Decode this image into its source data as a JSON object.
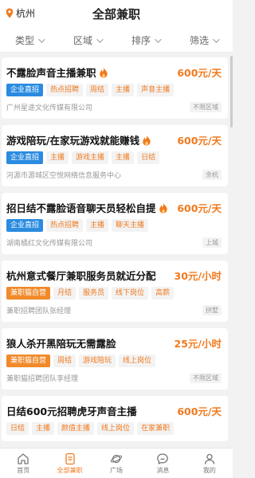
{
  "header": {
    "city": "杭州",
    "title": "全部兼职"
  },
  "filters": [
    {
      "label": "类型"
    },
    {
      "label": "区域"
    },
    {
      "label": "排序"
    },
    {
      "label": "筛选"
    }
  ],
  "jobs": [
    {
      "title": "不露脸声音主播兼职",
      "hot": true,
      "pay": "600元/天",
      "tags": [
        {
          "text": "企业直招",
          "style": "primary"
        },
        {
          "text": "热点招聘",
          "style": "plain"
        },
        {
          "text": "周结",
          "style": "plain"
        },
        {
          "text": "主播",
          "style": "plain"
        },
        {
          "text": "声音主播",
          "style": "plain"
        }
      ],
      "company": "广州星途文化传媒有限公司",
      "area": "不限区域"
    },
    {
      "title": "游戏陪玩/在家玩游戏就能赚钱",
      "hot": true,
      "pay": "600元/天",
      "tags": [
        {
          "text": "企业直招",
          "style": "primary"
        },
        {
          "text": "主播",
          "style": "plain"
        },
        {
          "text": "游戏主播",
          "style": "plain"
        },
        {
          "text": "主播",
          "style": "plain"
        },
        {
          "text": "日结",
          "style": "plain"
        }
      ],
      "company": "河源市源城区空悦网络信息服务中心",
      "area": "余杭"
    },
    {
      "title": "招日结不露脸语音聊天员轻松自提",
      "hot": true,
      "pay": "600元/天",
      "tags": [
        {
          "text": "企业直招",
          "style": "primary"
        },
        {
          "text": "热点招聘",
          "style": "plain"
        },
        {
          "text": "主播",
          "style": "plain"
        },
        {
          "text": "聊天主播",
          "style": "plain"
        }
      ],
      "company": "湖南橘红文化传媒有限公司",
      "area": "上城"
    },
    {
      "title": "杭州意式餐厅兼职服务员就近分配",
      "hot": false,
      "pay": "30元/小时",
      "tags": [
        {
          "text": "兼职猫自营",
          "style": "orange"
        },
        {
          "text": "月结",
          "style": "plain"
        },
        {
          "text": "服务员",
          "style": "plain"
        },
        {
          "text": "线下岗位",
          "style": "plain"
        },
        {
          "text": "高薪",
          "style": "plain"
        }
      ],
      "company": "兼职招聘团队张经理",
      "area": "拱墅"
    },
    {
      "title": "狼人杀开黑陪玩无需露脸",
      "hot": false,
      "pay": "25元/小时",
      "tags": [
        {
          "text": "兼职猫自营",
          "style": "orange"
        },
        {
          "text": "周结",
          "style": "plain"
        },
        {
          "text": "游戏陪玩",
          "style": "plain"
        },
        {
          "text": "线上岗位",
          "style": "plain"
        }
      ],
      "company": "兼职猫招聘团队李经理",
      "area": "不限区域"
    },
    {
      "title": "日结600元招聘虎牙声音主播",
      "hot": false,
      "pay": "600元/天",
      "tags": [
        {
          "text": "日结",
          "style": "plain"
        },
        {
          "text": "主播",
          "style": "plain"
        },
        {
          "text": "颜值主播",
          "style": "plain"
        },
        {
          "text": "线上岗位",
          "style": "plain"
        },
        {
          "text": "在家兼职",
          "style": "plain"
        }
      ],
      "company": "",
      "area": ""
    }
  ],
  "tabbar": [
    {
      "label": "首页",
      "icon": "home-icon",
      "active": false
    },
    {
      "label": "全部兼职",
      "icon": "document-icon",
      "active": true
    },
    {
      "label": "广场",
      "icon": "planet-icon",
      "active": false
    },
    {
      "label": "消息",
      "icon": "chat-icon",
      "active": false
    },
    {
      "label": "我的",
      "icon": "user-icon",
      "active": false
    }
  ],
  "colors": {
    "accent": "#f07a1e",
    "primary_tag": "#2a8be0",
    "self_tag": "#f08a2a"
  }
}
